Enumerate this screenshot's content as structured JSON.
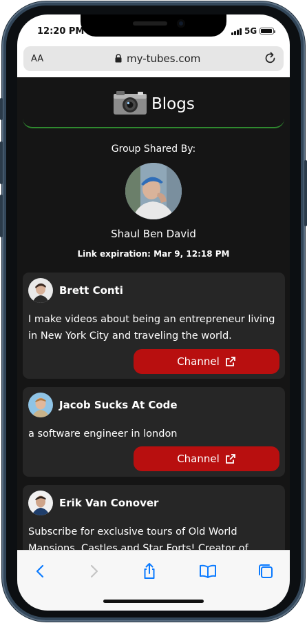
{
  "status_bar": {
    "time": "12:20 PM",
    "network": "5G"
  },
  "browser": {
    "text_size_label": "AA",
    "url": "my-tubes.com"
  },
  "header": {
    "title": "Blogs"
  },
  "group": {
    "shared_by_label": "Group Shared By:",
    "owner_name": "Shaul Ben David",
    "expiry_text": "Link expiration: Mar 9, 12:18 PM"
  },
  "cards": [
    {
      "name": "Brett Conti",
      "description": "I make videos about being an entrepreneur living in New York City and traveling the world.",
      "button_label": "Channel"
    },
    {
      "name": "Jacob Sucks At Code",
      "description": "a software engineer in london",
      "button_label": "Channel"
    },
    {
      "name": "Erik Van Conover",
      "description": "Subscribe for exclusive tours of Old World Mansions, Castles and Star Forts! Creator of"
    }
  ],
  "toolbar": {
    "icons": [
      "back-icon",
      "forward-icon",
      "share-icon",
      "bookmarks-icon",
      "tabs-icon"
    ]
  },
  "colors": {
    "accent_red": "#b80f0f",
    "header_border_green": "#2f8a2f",
    "page_bg": "#151515",
    "card_bg": "#262626",
    "ios_blue": "#0a7aff"
  }
}
